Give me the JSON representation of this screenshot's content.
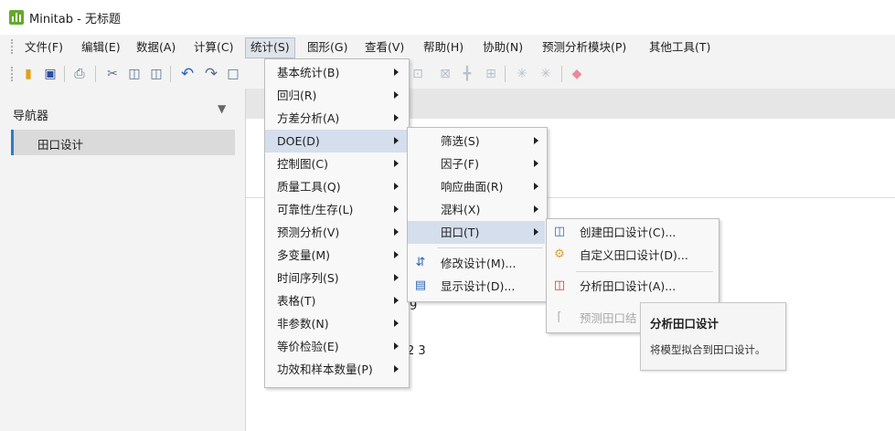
{
  "window": {
    "title": "Minitab - 无标题"
  },
  "menubar": [
    "文件(F)",
    "编辑(E)",
    "数据(A)",
    "计算(C)",
    "统计(S)",
    "图形(G)",
    "查看(V)",
    "帮助(H)",
    "协助(N)",
    "预测分析模块(P)",
    "其他工具(T)"
  ],
  "navigator": {
    "title": "导航器",
    "items": [
      "田口设计"
    ]
  },
  "workspace": {
    "frag_9": "9",
    "frag_23": "2 3"
  },
  "stat_menu": [
    "基本统计(B)",
    "回归(R)",
    "方差分析(A)",
    "DOE(D)",
    "控制图(C)",
    "质量工具(Q)",
    "可靠性/生存(L)",
    "预测分析(V)",
    "多变量(M)",
    "时间序列(S)",
    "表格(T)",
    "非参数(N)",
    "等价检验(E)",
    "功效和样本数量(P)"
  ],
  "doe_menu": [
    "筛选(S)",
    "因子(F)",
    "响应曲面(R)",
    "混料(X)",
    "田口(T)",
    "修改设计(M)...",
    "显示设计(D)..."
  ],
  "taguchi_menu": [
    "创建田口设计(C)...",
    "自定义田口设计(D)...",
    "分析田口设计(A)...",
    "预测田口结"
  ],
  "tooltip": {
    "title": "分析田口设计",
    "body": "将模型拟合到田口设计。"
  },
  "colors": {
    "highlight": "#d4deed",
    "accent": "#2f7cc4",
    "icon_red": "#d9302a",
    "icon_blue": "#2b63b8"
  }
}
